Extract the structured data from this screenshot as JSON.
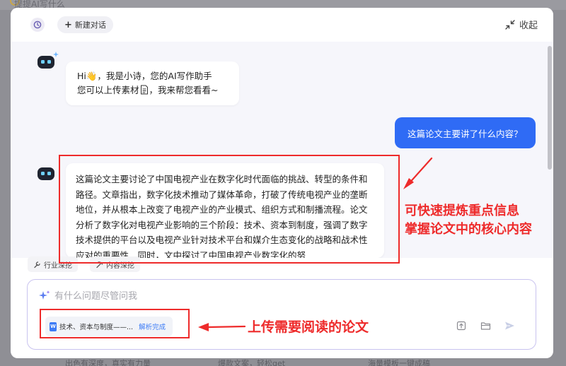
{
  "background": {
    "top_ghost_text": "提提AI写什么",
    "bottom_items": [
      "出色有深度，真实有力量",
      "爆款文案，轻松get",
      "海量模板一键成稿"
    ]
  },
  "header": {
    "new_chat_label": "新建对话",
    "collapse_label": "收起"
  },
  "chat": {
    "bot_greeting_line1": "Hi👋，我是小诗，您的AI写作助手",
    "bot_greeting_line2_pre": "您可以上传素材",
    "bot_greeting_line2_post": "，我来帮您看看~",
    "user_message": "这篇论文主要讲了什么内容？",
    "bot_answer": "这篇论文主要讨论了中国电视产业在数字化时代面临的挑战、转型的条件和路径。文章指出，数字化技术推动了媒体革命，打破了传统电视产业的垄断地位，并从根本上改变了电视产业的产业模式、组织方式和制播流程。论文分析了数字化对电视产业影响的三个阶段：技术、资本到制度，强调了数字技术提供的平台以及电视产业针对技术平台和媒介生态变化的战略和战术性应对的重要性。同时，文中探讨了中国电视产业数字化的努"
  },
  "tools": {
    "industry_label": "行业深挖",
    "content_label": "内容深挖"
  },
  "input": {
    "placeholder": "有什么问题尽管问我",
    "file_name": "技术、资本与制度——...",
    "file_status": "解析完成"
  },
  "annotations": {
    "answer_note_line1": "可快速提炼重点信息",
    "answer_note_line2": "掌握论文中的核心内容",
    "upload_note": "上传需要阅读的论文",
    "color": "#ee2b2b"
  },
  "colors": {
    "accent": "#2f6bf5",
    "chat_bg": "#f6f6fb",
    "annotation": "#ee2b2b"
  }
}
